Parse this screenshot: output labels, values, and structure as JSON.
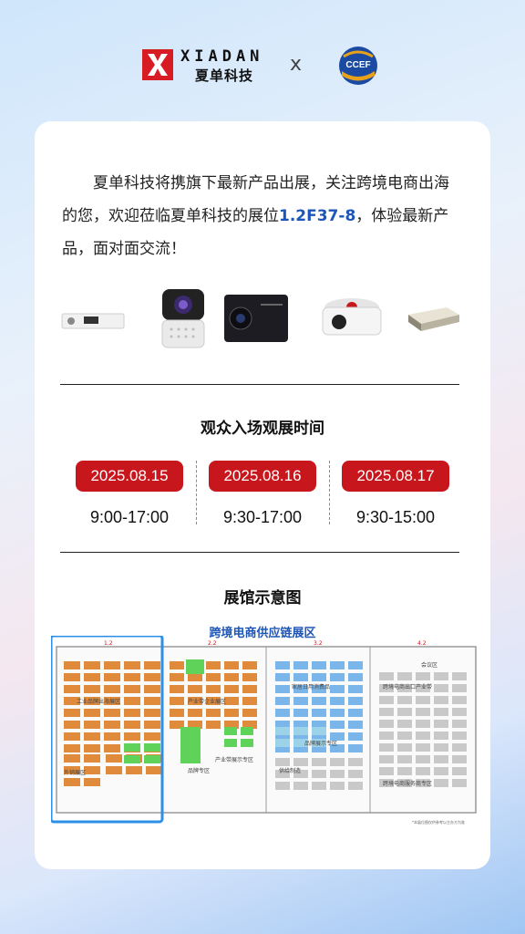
{
  "brand": {
    "name_en": "XIADAN",
    "name_cn": "夏单科技",
    "separator": "x",
    "partner": "CCEF"
  },
  "intro": {
    "part1": "夏单科技将携旗下最新产品出展，关注跨境电商出海的您，欢迎莅临夏单科技的展位",
    "booth": "1.2F37-8",
    "part2": "，体验最新产品，面对面交流！"
  },
  "products": [
    "mini-projector-white",
    "projector-cube-white",
    "projector-black",
    "projector-round-white",
    "projector-gold-flat"
  ],
  "schedule": {
    "title": "观众入场观展时间",
    "days": [
      {
        "date": "2025.08.15",
        "hours": "9:00-17:00"
      },
      {
        "date": "2025.08.16",
        "hours": "9:30-17:00"
      },
      {
        "date": "2025.08.17",
        "hours": "9:30-15:00"
      }
    ]
  },
  "map": {
    "title": "展馆示意图",
    "zone_title": "跨境电商供应链展区",
    "halls": [
      "1.2",
      "2.2",
      "3.2",
      "4.2"
    ],
    "labels": {
      "hall1": "工业品牌出海展区",
      "hall1b": "外销展区",
      "hall2": "产业带企业展区",
      "hall2b": "品牌专区",
      "hall2c": "产业带展示专区",
      "hall3": "家居日用消费品",
      "hall3b": "供给制造",
      "hall3c": "品牌展示专区",
      "hall4": "跨境电商出口产业带",
      "hall4b": "会议区",
      "hall4c": "跨境电商服务商专区"
    },
    "footnote": "*本展位图仅供参考以主办方为准"
  },
  "colors": {
    "accent_red": "#c8161d",
    "accent_blue": "#1e56b8",
    "highlight": "#2e8fe6"
  }
}
